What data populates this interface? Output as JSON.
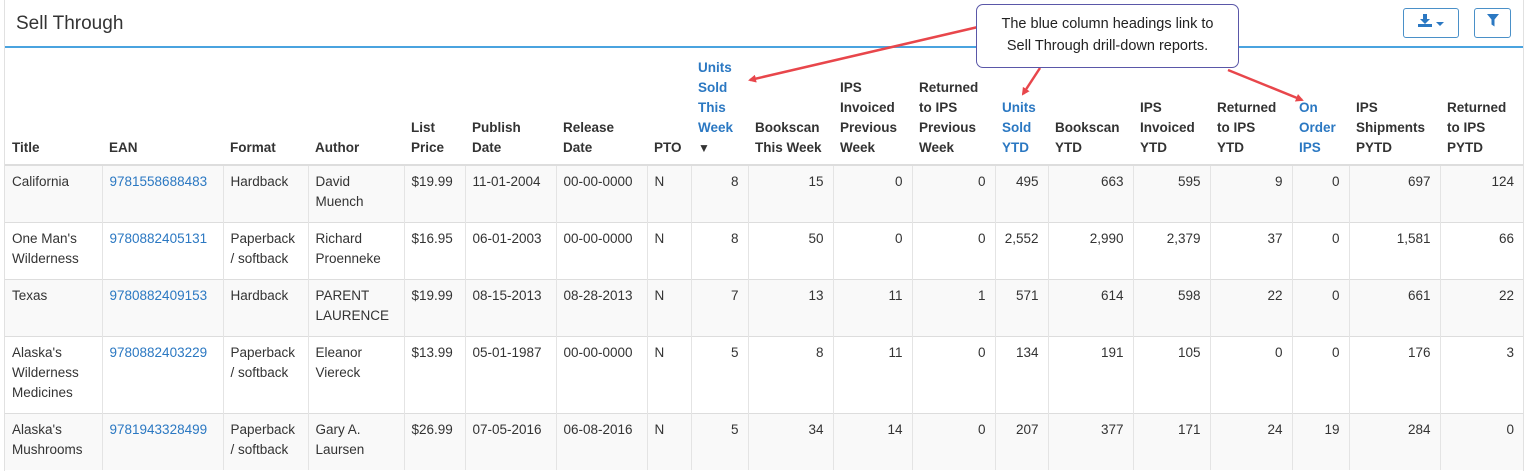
{
  "panel": {
    "title": "Sell Through",
    "download_icon": "download-icon",
    "filter_icon": "filter-icon"
  },
  "callout": {
    "line1": "The blue column headings link to",
    "line2": "Sell Through drill-down reports."
  },
  "colors": {
    "link": "#2b78c2",
    "header_rule": "#4aa3df",
    "arrow": "#e8464b",
    "callout_border": "#5a57a8"
  },
  "table": {
    "headers": [
      {
        "label": "Title",
        "link": false
      },
      {
        "label": "EAN",
        "link": false
      },
      {
        "label": "Format",
        "link": false
      },
      {
        "label": "Author",
        "link": false
      },
      {
        "label": "List Price",
        "link": false
      },
      {
        "label": "Publish Date",
        "link": false
      },
      {
        "label": "Release Date",
        "link": false
      },
      {
        "label": "PTO",
        "link": false
      },
      {
        "label": "Units Sold This Week",
        "link": true,
        "sort": "▼"
      },
      {
        "label": "Bookscan This Week",
        "link": false
      },
      {
        "label": "IPS Invoiced Previous Week",
        "link": false
      },
      {
        "label": "Returned to IPS Previous Week",
        "link": false
      },
      {
        "label": "Units Sold YTD",
        "link": true
      },
      {
        "label": "Bookscan YTD",
        "link": false
      },
      {
        "label": "IPS Invoiced YTD",
        "link": false
      },
      {
        "label": "Returned to IPS YTD",
        "link": false
      },
      {
        "label": "On Order IPS",
        "link": true
      },
      {
        "label": "IPS Shipments PYTD",
        "link": false
      },
      {
        "label": "Returned to IPS PYTD",
        "link": false
      }
    ],
    "rows": [
      {
        "title": "California",
        "ean": "9781558688483",
        "format": "Hardback",
        "author": "David Muench",
        "list_price": "$19.99",
        "publish_date": "11-01-2004",
        "release_date": "00-00-0000",
        "pto": "N",
        "units_sold_week": "8",
        "bookscan_week": "15",
        "ips_invoiced_prev": "0",
        "returned_prev": "0",
        "units_sold_ytd": "495",
        "bookscan_ytd": "663",
        "ips_invoiced_ytd": "595",
        "returned_ytd": "9",
        "on_order": "0",
        "ips_shipments_pytd": "697",
        "returned_pytd": "124"
      },
      {
        "title": "One Man's Wilderness",
        "ean": "9780882405131",
        "format": "Paperback / softback",
        "author": "Richard Proenneke",
        "list_price": "$16.95",
        "publish_date": "06-01-2003",
        "release_date": "00-00-0000",
        "pto": "N",
        "units_sold_week": "8",
        "bookscan_week": "50",
        "ips_invoiced_prev": "0",
        "returned_prev": "0",
        "units_sold_ytd": "2,552",
        "bookscan_ytd": "2,990",
        "ips_invoiced_ytd": "2,379",
        "returned_ytd": "37",
        "on_order": "0",
        "ips_shipments_pytd": "1,581",
        "returned_pytd": "66"
      },
      {
        "title": "Texas",
        "ean": "9780882409153",
        "format": "Hardback",
        "author": "PARENT LAURENCE",
        "list_price": "$19.99",
        "publish_date": "08-15-2013",
        "release_date": "08-28-2013",
        "pto": "N",
        "units_sold_week": "7",
        "bookscan_week": "13",
        "ips_invoiced_prev": "11",
        "returned_prev": "1",
        "units_sold_ytd": "571",
        "bookscan_ytd": "614",
        "ips_invoiced_ytd": "598",
        "returned_ytd": "22",
        "on_order": "0",
        "ips_shipments_pytd": "661",
        "returned_pytd": "22"
      },
      {
        "title": "Alaska's Wilderness Medicines",
        "ean": "9780882403229",
        "format": "Paperback / softback",
        "author": "Eleanor Viereck",
        "list_price": "$13.99",
        "publish_date": "05-01-1987",
        "release_date": "00-00-0000",
        "pto": "N",
        "units_sold_week": "5",
        "bookscan_week": "8",
        "ips_invoiced_prev": "11",
        "returned_prev": "0",
        "units_sold_ytd": "134",
        "bookscan_ytd": "191",
        "ips_invoiced_ytd": "105",
        "returned_ytd": "0",
        "on_order": "0",
        "ips_shipments_pytd": "176",
        "returned_pytd": "3"
      },
      {
        "title": "Alaska's Mushrooms",
        "ean": "9781943328499",
        "format": "Paperback / softback",
        "author": "Gary A. Laursen",
        "list_price": "$26.99",
        "publish_date": "07-05-2016",
        "release_date": "06-08-2016",
        "pto": "N",
        "units_sold_week": "5",
        "bookscan_week": "34",
        "ips_invoiced_prev": "14",
        "returned_prev": "0",
        "units_sold_ytd": "207",
        "bookscan_ytd": "377",
        "ips_invoiced_ytd": "171",
        "returned_ytd": "24",
        "on_order": "19",
        "ips_shipments_pytd": "284",
        "returned_pytd": "0"
      }
    ]
  }
}
